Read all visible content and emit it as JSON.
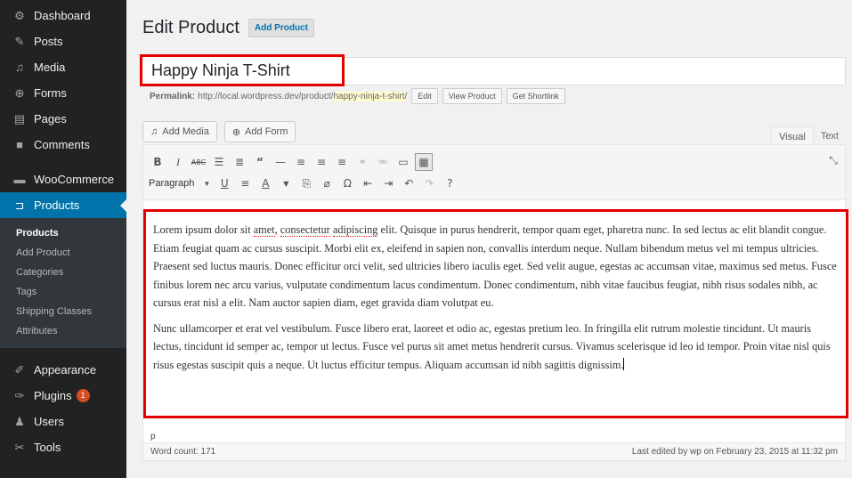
{
  "sidebar": {
    "top_items": [
      {
        "label": "Dashboard",
        "icon": "dashboard-icon",
        "glyph": "⚙"
      },
      {
        "label": "Posts",
        "icon": "pin-icon",
        "glyph": "✎"
      },
      {
        "label": "Media",
        "icon": "media-icon",
        "glyph": "♫"
      },
      {
        "label": "Forms",
        "icon": "forms-icon",
        "glyph": "⊕"
      },
      {
        "label": "Pages",
        "icon": "pages-icon",
        "glyph": "▤"
      },
      {
        "label": "Comments",
        "icon": "comments-icon",
        "glyph": "■"
      }
    ],
    "woocommerce": {
      "label": "WooCommerce",
      "icon": "woocommerce-icon",
      "glyph": "▬"
    },
    "products": {
      "label": "Products",
      "icon": "cart-icon",
      "glyph": "⊐"
    },
    "submenu": [
      "Products",
      "Add Product",
      "Categories",
      "Tags",
      "Shipping Classes",
      "Attributes"
    ],
    "bottom_items": [
      {
        "label": "Appearance",
        "icon": "brush-icon",
        "glyph": "✐"
      },
      {
        "label": "Plugins",
        "icon": "plugin-icon",
        "glyph": "✑",
        "badge": "1"
      },
      {
        "label": "Users",
        "icon": "users-icon",
        "glyph": "♟"
      },
      {
        "label": "Tools",
        "icon": "tools-icon",
        "glyph": "✂"
      }
    ]
  },
  "header": {
    "title": "Edit Product",
    "add_button": "Add Product"
  },
  "post_title": "Happy Ninja T-Shirt",
  "permalink": {
    "label": "Permalink:",
    "base": "http://local.wordpress.dev/product/",
    "slug": "happy-ninja-t-shirt",
    "trail": "/",
    "edit": "Edit",
    "view": "View Product",
    "shortlink": "Get Shortlink"
  },
  "media_buttons": {
    "add_media": "Add Media",
    "add_form": "Add Form"
  },
  "tabs": {
    "visual": "Visual",
    "text": "Text"
  },
  "toolbar": {
    "format": "Paragraph"
  },
  "content": {
    "p1": {
      "a": "Lorem ipsum dolor sit ",
      "s1": "amet",
      "b": ", ",
      "s2": "consectetur",
      "c": " ",
      "s3": "adipiscing",
      "d": " elit. Quisque in purus hendrerit, tempor quam eget, pharetra nunc. In sed lectus ac elit blandit congue. Etiam feugiat quam ac cursus suscipit. Morbi elit ex, eleifend in sapien non, convallis interdum neque. Nullam bibendum metus vel mi tempus ultricies. Praesent sed luctus mauris. Donec efficitur orci velit, sed ultricies libero iaculis eget. Sed velit augue, egestas ac accumsan vitae, maximus sed metus. Fusce finibus lorem nec arcu varius, vulputate condimentum lacus condimentum. Donec condimentum, nibh vitae faucibus feugiat, nibh risus sodales nibh, ac cursus erat nisl a elit. Nam auctor sapien diam, eget gravida diam volutpat eu."
    },
    "p2": "Nunc ullamcorper et erat vel vestibulum. Fusce libero erat, laoreet et odio ac, egestas pretium leo. In fringilla elit rutrum molestie tincidunt. Ut mauris lectus, tincidunt id semper ac, tempor ut lectus. Fusce vel purus sit amet metus hendrerit cursus. Vivamus scelerisque id leo id tempor. Proin vitae nisl quis risus egestas suscipit quis a neque. Ut luctus efficitur tempus. Aliquam accumsan id nibh sagittis dignissim."
  },
  "path": "p",
  "status": {
    "word_count": "Word count: 171",
    "last_edited": "Last edited by wp on February 23, 2015 at 11:32 pm"
  },
  "colors": {
    "accent": "#0073aa",
    "highlight": "#e50000",
    "sidebar": "#222222"
  }
}
